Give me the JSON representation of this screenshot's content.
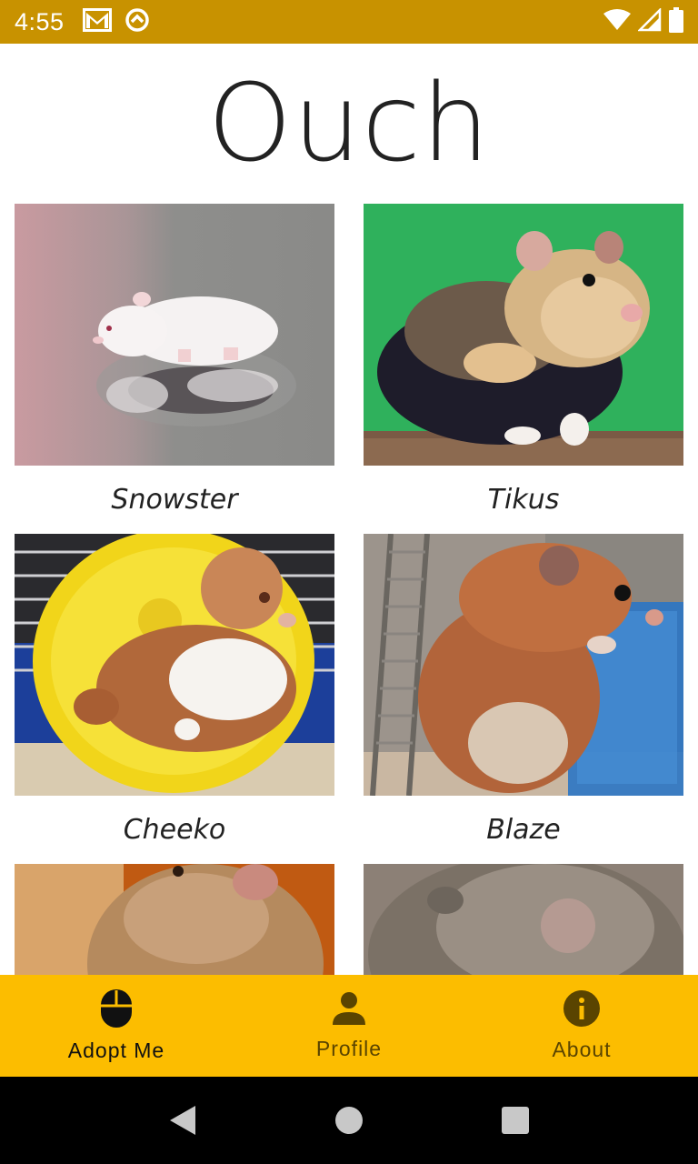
{
  "status_bar": {
    "time": "4:55",
    "left_icons": [
      "gmail-icon",
      "sync-icon"
    ],
    "right_icons": [
      "wifi-icon",
      "signal-icon",
      "battery-icon"
    ],
    "color": "#C89200"
  },
  "title": "Ouch",
  "hamsters": [
    {
      "name": "Snowster"
    },
    {
      "name": "Tikus"
    },
    {
      "name": "Cheeko"
    },
    {
      "name": "Blaze"
    },
    {
      "name": ""
    },
    {
      "name": ""
    }
  ],
  "bottom_nav": {
    "color": "#FCBD00",
    "items": [
      {
        "label": "Adopt Me",
        "icon": "mouse-icon",
        "active": true
      },
      {
        "label": "Profile",
        "icon": "person-icon",
        "active": false
      },
      {
        "label": "About",
        "icon": "info-icon",
        "active": false
      }
    ]
  },
  "system_nav": [
    "back-icon",
    "home-icon",
    "recents-icon"
  ]
}
